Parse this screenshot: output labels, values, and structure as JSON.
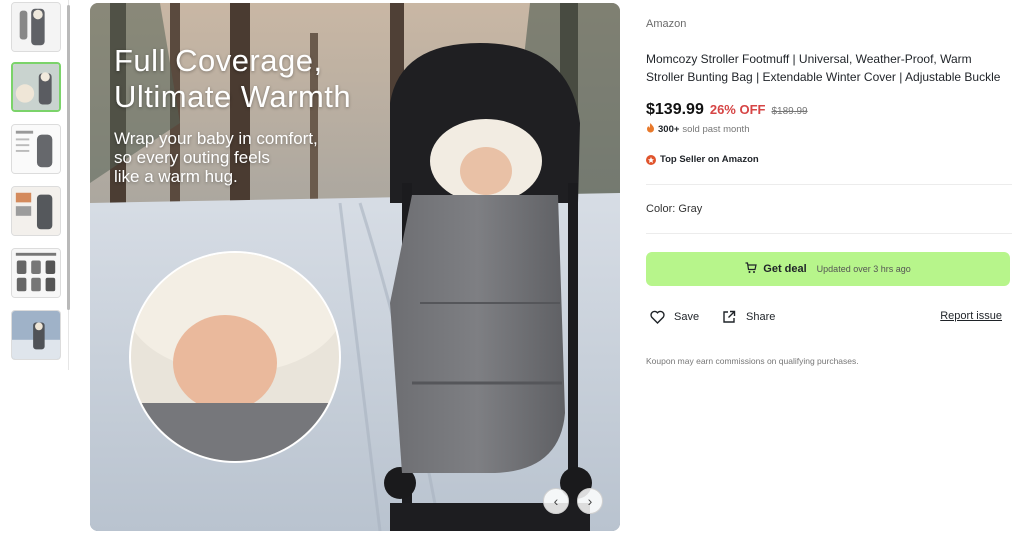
{
  "thumbnails": [
    {
      "name": "thumb-1-stroller-side"
    },
    {
      "name": "thumb-2-baby-closeup"
    },
    {
      "name": "thumb-3-size-chart"
    },
    {
      "name": "thumb-4-product-detail"
    },
    {
      "name": "thumb-5-product-grid"
    },
    {
      "name": "thumb-6-outdoor-stroller"
    }
  ],
  "hero": {
    "title_line1": "Full Coverage,",
    "title_line2": "Ultimate Warmth",
    "subtitle_line1": "Wrap your baby in comfort,",
    "subtitle_line2": "so every outing feels",
    "subtitle_line3": "like a warm hug.",
    "prev_icon": "‹",
    "next_icon": "›"
  },
  "product": {
    "brand": "Amazon",
    "title": "Momcozy Stroller Footmuff | Universal, Weather-Proof, Warm Stroller Bunting Bag | Extendable Winter Cover | Adjustable Buckle",
    "price": "$139.99",
    "discount": "26% OFF",
    "original_price": "$189.99",
    "sold_count": "300+",
    "sold_text": "sold past month",
    "badge": "Top Seller on Amazon",
    "color_label": "Color: Gray"
  },
  "actions": {
    "deal_label": "Get deal",
    "deal_updated": "Updated over 3 hrs ago",
    "save_label": "Save",
    "share_label": "Share",
    "report_label": "Report issue"
  },
  "disclaimer": "Koupon may earn commissions on qualifying purchases.",
  "colors": {
    "accent_green": "#b7f58b",
    "discount_red": "#d64545",
    "badge_orange": "#e0542c"
  }
}
